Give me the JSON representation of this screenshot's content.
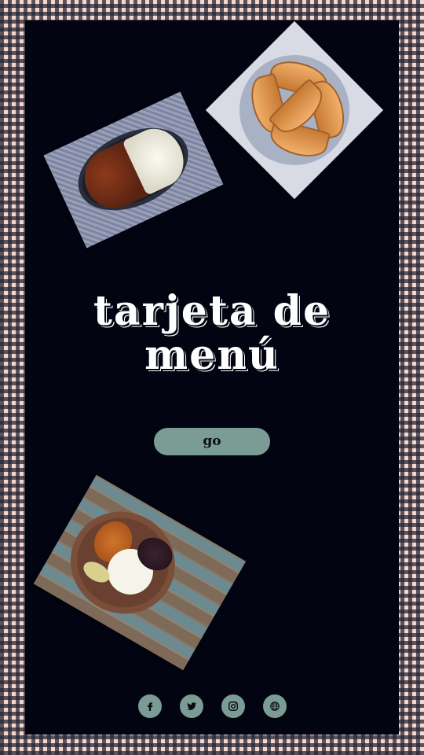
{
  "title": {
    "line1": "tarjeta de",
    "line2": "menú"
  },
  "cta": {
    "label": "go"
  },
  "images": [
    {
      "name": "rice-and-beans-photo",
      "alt": "plato de arroz y frijoles"
    },
    {
      "name": "empanadas-photo",
      "alt": "empanadas"
    },
    {
      "name": "casado-plate-photo",
      "alt": "plato típico"
    }
  ],
  "social": [
    {
      "icon": "facebook-icon"
    },
    {
      "icon": "twitter-icon"
    },
    {
      "icon": "instagram-icon"
    },
    {
      "icon": "globe-icon"
    }
  ],
  "colors": {
    "background": "#020412",
    "accent": "#7b9c95",
    "border_pink": "#f4d8d0",
    "border_dark": "#282634",
    "text": "#ffffff"
  }
}
